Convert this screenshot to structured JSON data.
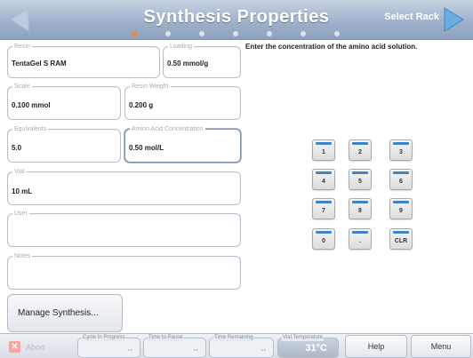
{
  "header": {
    "title": "Synthesis Properties",
    "select_rack": "Select Rack",
    "active_step": 0,
    "step_count": 7,
    "colors": {
      "active_dot": "#f08a2a",
      "inactive_dot": "#dde4ee",
      "nav_arrow": "#6aaee0"
    }
  },
  "fields": {
    "resin": {
      "label": "Resin",
      "value": "TentaGel S RAM"
    },
    "loading": {
      "label": "Loading",
      "value": "0.50 mmol/g"
    },
    "scale": {
      "label": "Scale",
      "value": "0.100 mmol"
    },
    "resin_weight": {
      "label": "Resin Weight",
      "value": "0.200 g"
    },
    "equivalents": {
      "label": "Equivalents",
      "value": "5.0"
    },
    "amino_acid_concentration": {
      "label": "Amino Acid Concentration",
      "value": "0.50 mol/L"
    },
    "vial": {
      "label": "Vial",
      "value": "10 mL"
    },
    "user": {
      "label": "User",
      "value": ""
    },
    "notes": {
      "label": "Notes",
      "value": ""
    }
  },
  "instruction": "Enter the concentration of the amino acid solution.",
  "keypad": {
    "k1": "1",
    "k2": "2",
    "k3": "3",
    "k4": "4",
    "k5": "5",
    "k6": "6",
    "k7": "7",
    "k8": "8",
    "k9": "9",
    "k0": "0",
    "kdot": ".",
    "kclr": "CLR"
  },
  "manage_button": "Manage Synthesis...",
  "bottom": {
    "abort": "Abort",
    "cycle_label": "Cycle In Progress",
    "cycle_value": "--",
    "pause_label": "Time to Pause",
    "pause_value": "--",
    "remaining_label": "Time Remaining",
    "remaining_value": "--",
    "temp_label": "Vial Temperature",
    "temp_value": "31°C",
    "help": "Help",
    "menu": "Menu"
  }
}
